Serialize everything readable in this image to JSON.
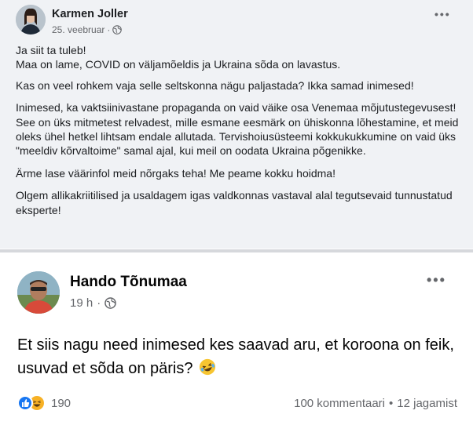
{
  "post1": {
    "author": "Karmen Joller",
    "date": "25. veebruar",
    "more_icon": "more-dots-icon",
    "paragraphs": [
      "Ja siit ta tuleb!",
      "Maa on lame, COVID on väljamõeldis ja Ukraina sõda on lavastus.",
      "Kas on veel rohkem vaja selle seltskonna nägu paljastada? Ikka samad inimesed!",
      "Inimesed, ka vaktsiinivastane propaganda on vaid väike osa Venemaa mõjutustegevusest! See on üks mitmetest relvadest, mille esmane eesmärk on ühiskonna lõhestamine, et meid oleks ühel hetkel lihtsam endale allutada. Tervishoiusüsteemi kokkukukkumine on vaid üks \"meeldiv kõrvaltoime\" samal ajal, kui meil on oodata Ukraina põgenikke.",
      "Ärme lase väärinfol meid nõrgaks teha! Me peame kokku hoidma!",
      "Olgem allikakriitilised ja usaldagem igas valdkonnas vastaval alal tegutsevaid tunnustatud eksperte!"
    ]
  },
  "post2": {
    "author": "Hando Tõnumaa",
    "time": "19 h",
    "dot": "·",
    "text": "Et siis nagu need inimesed kes saavad aru, et koroona on feik, usuvad et sõda on päris?",
    "reaction_count": "190",
    "comments": "100 kommentaari",
    "separator": "•",
    "shares": "12 jagamist"
  },
  "colors": {
    "post1_bg": "#f0f2f5",
    "like_blue": "#1877f2",
    "haha_yellow": "#f7b125",
    "secondary_text": "#65676b"
  }
}
